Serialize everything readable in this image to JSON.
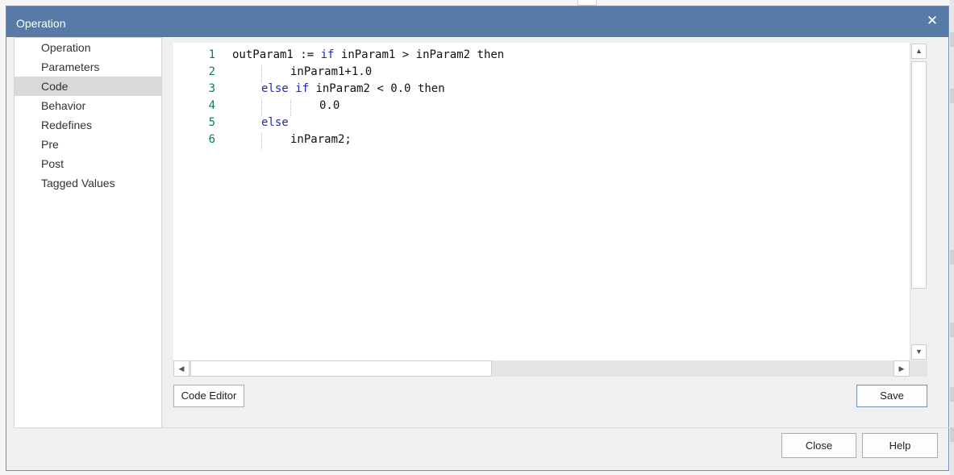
{
  "dialog": {
    "title": "Operation",
    "close_glyph": "✕"
  },
  "sidebar": {
    "items": [
      {
        "label": "Operation"
      },
      {
        "label": "Parameters"
      },
      {
        "label": "Code"
      },
      {
        "label": "Behavior"
      },
      {
        "label": "Redefines"
      },
      {
        "label": "Pre"
      },
      {
        "label": "Post"
      },
      {
        "label": "Tagged Values"
      }
    ],
    "selected": "Code"
  },
  "editor": {
    "lines": [
      {
        "num": "1",
        "code": "outParam1 := if inParam1 > inParam2 then"
      },
      {
        "num": "2",
        "code": "inParam1+1.0"
      },
      {
        "num": "3",
        "code": "else if inParam2 < 0.0 then"
      },
      {
        "num": "4",
        "code": "0.0"
      },
      {
        "num": "5",
        "code": "else"
      },
      {
        "num": "6",
        "code": "inParam2;"
      }
    ],
    "keyword_color": "#1a2bbf",
    "line_number_color": "#0d7a6a"
  },
  "buttons": {
    "code_editor": "Code Editor",
    "save": "Save",
    "close": "Close",
    "help": "Help"
  },
  "scroll": {
    "up_icon": "▲",
    "down_icon": "▼",
    "left_icon": "◀",
    "right_icon": "▶"
  },
  "colors": {
    "titlebar": "#577ba6",
    "selection": "#d9d9d9"
  }
}
